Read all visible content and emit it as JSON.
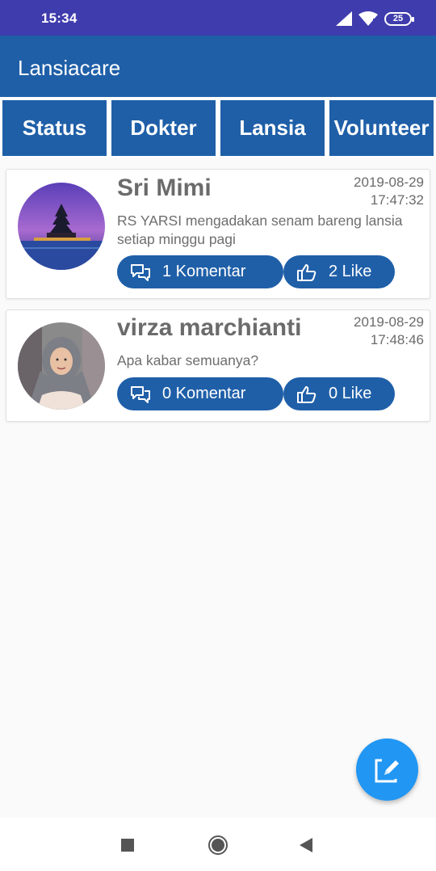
{
  "status_bar": {
    "time": "15:34",
    "battery": "25"
  },
  "app_bar": {
    "title": "Lansiacare"
  },
  "tabs": [
    {
      "label": "Status"
    },
    {
      "label": "Dokter"
    },
    {
      "label": "Lansia"
    },
    {
      "label": "Volunteer"
    }
  ],
  "posts": [
    {
      "name": "Sri Mimi",
      "date": "2019-08-29",
      "time": "17:47:32",
      "message": "RS YARSI mengadakan senam bareng lansia setiap minggu pagi",
      "comments": "1 Komentar",
      "likes": "2 Like"
    },
    {
      "name": "virza marchianti",
      "date": "2019-08-29",
      "time": "17:48:46",
      "message": "Apa kabar semuanya?",
      "comments": "0 Komentar",
      "likes": "0 Like"
    }
  ],
  "colors": {
    "primary": "#1f5fa8",
    "status_bar": "#3f3cad",
    "fab": "#2196f3"
  },
  "icons": {
    "fab": "edit-icon",
    "comment": "comment-icon",
    "like": "thumbs-up-icon"
  }
}
